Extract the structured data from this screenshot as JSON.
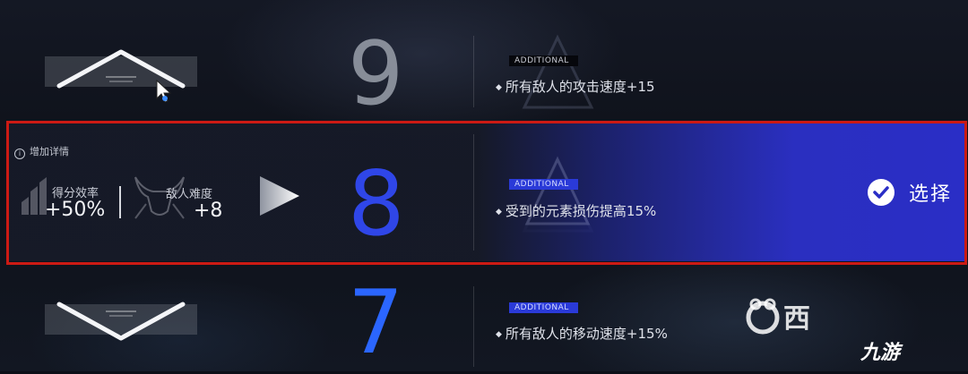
{
  "rows": {
    "top": {
      "level": "9",
      "tag": "ADDITIONAL",
      "effect": "所有敌人的攻击速度+15"
    },
    "selected": {
      "level": "8",
      "tag": "ADDITIONAL",
      "effect": "受到的元素损伤提高15%",
      "detail_label": "增加详情",
      "score_label": "得分效率",
      "score_value": "+50%",
      "difficulty_label": "敌人难度",
      "difficulty_value": "+8",
      "select_label": "选择"
    },
    "bottom": {
      "level": "7",
      "tag": "ADDITIONAL",
      "effect": "所有敌人的移动速度+15%"
    }
  },
  "watermark": {
    "partial_text": "西",
    "logo_text": "九游"
  },
  "colors": {
    "selected_number": "#2f46e8",
    "bottom_number": "#2b66ff",
    "highlight_border": "#cc1a14",
    "select_band": "#2a2ec6"
  },
  "icons": [
    "chevron-up-icon",
    "chevron-down-icon",
    "cursor-icon",
    "score-bars-icon",
    "enemy-bull-icon",
    "play-arrow-icon",
    "check-icon",
    "info-icon",
    "triangle-emblem-icon"
  ]
}
